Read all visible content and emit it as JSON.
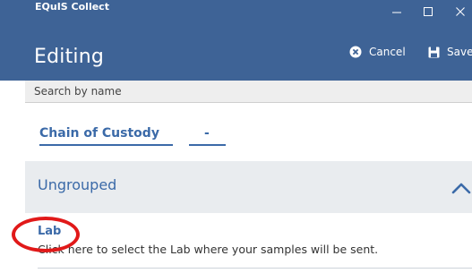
{
  "window": {
    "app_title": "EQuIS Collect",
    "controls": [
      "minimize-icon",
      "maximize-icon",
      "close-icon"
    ]
  },
  "header": {
    "title": "Editing",
    "cancel_label": "Cancel",
    "save_label": "Save",
    "cancel_icon": "cancel-circle-icon",
    "save_icon": "save-floppy-icon"
  },
  "search": {
    "placeholder": "Search by name",
    "icon": "search-icon"
  },
  "chain_of_custody": {
    "label": "Chain of Custody",
    "value": "-"
  },
  "groups": [
    {
      "label": "Ungrouped",
      "expanded": true,
      "fields": [
        {
          "label": "Lab",
          "hint": "Click here to select the Lab where your samples will be sent."
        }
      ]
    }
  ],
  "colors": {
    "header_bg": "#3e6396",
    "accent_blue": "#3b6aa8",
    "group_bg": "#e9ecef",
    "annotation_red": "#e11919"
  }
}
